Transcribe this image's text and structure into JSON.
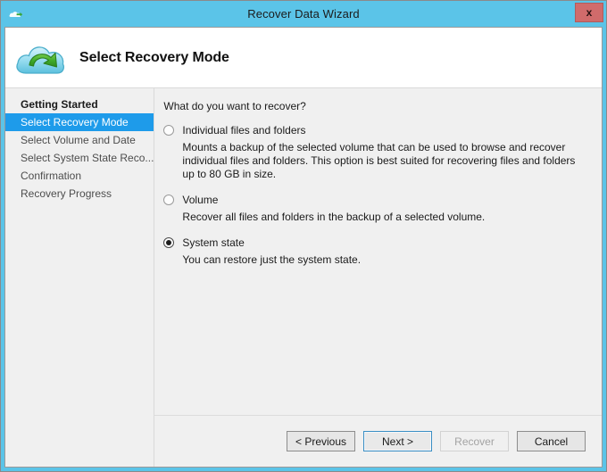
{
  "window": {
    "title": "Recover Data Wizard",
    "title_icon": "cloud-icon",
    "close_label": "x"
  },
  "banner": {
    "icon": "cloud-restore-icon",
    "title": "Select Recovery Mode"
  },
  "sidebar": {
    "items": [
      {
        "label": "Getting Started",
        "state": "done"
      },
      {
        "label": "Select Recovery Mode",
        "state": "current"
      },
      {
        "label": "Select Volume and Date",
        "state": "pending"
      },
      {
        "label": "Select System State Reco...",
        "state": "pending"
      },
      {
        "label": "Confirmation",
        "state": "pending"
      },
      {
        "label": "Recovery Progress",
        "state": "pending"
      }
    ]
  },
  "main": {
    "question": "What do you want to recover?",
    "options": [
      {
        "label": "Individual files and folders",
        "description": "Mounts a backup of the selected volume that can be used to browse and recover individual files and folders. This option is best suited for recovering files and folders up to 80 GB in size.",
        "selected": false
      },
      {
        "label": "Volume",
        "description": "Recover all files and folders in the backup of a selected volume.",
        "selected": false
      },
      {
        "label": "System state",
        "description": "You can restore just the system state.",
        "selected": true
      }
    ]
  },
  "buttons": {
    "previous": "< Previous",
    "next": "Next >",
    "recover": "Recover",
    "cancel": "Cancel"
  },
  "colors": {
    "titlebar": "#5bc4e8",
    "accent_selection": "#1e9bea",
    "close_button": "#d06b6b",
    "panel_bg": "#f0f0f0"
  }
}
